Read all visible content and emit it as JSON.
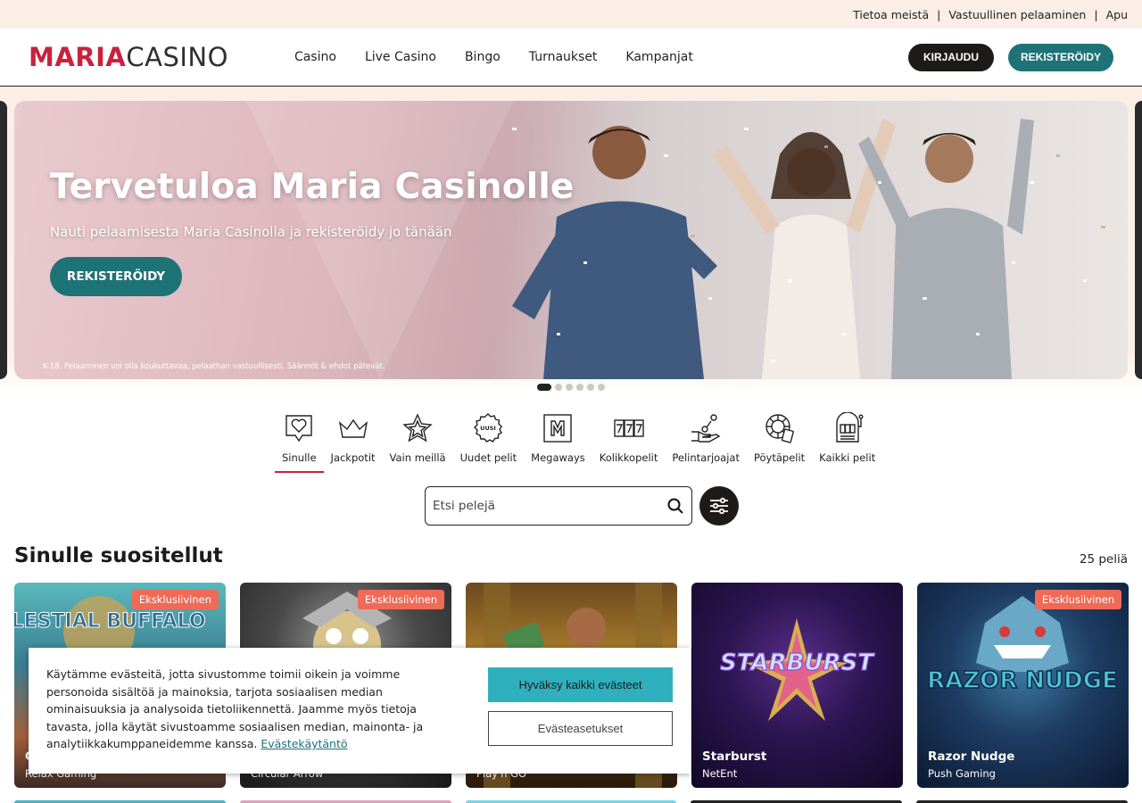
{
  "topbar": {
    "links": [
      "Tietoa meistä",
      "Vastuullinen pelaaminen",
      "Apu"
    ],
    "separator": "|"
  },
  "header": {
    "logo_part1": "MARIA",
    "logo_part2": "CASINO",
    "nav": [
      "Casino",
      "Live Casino",
      "Bingo",
      "Turnaukset",
      "Kampanjat"
    ],
    "login_label": "KIRJAUDU",
    "register_label": "REKISTERÖIDY"
  },
  "hero": {
    "title": "Tervetuloa Maria Casinolle",
    "subtitle": "Nauti pelaamisesta Maria Casinolla ja rekisteröidy jo tänään",
    "cta": "REKISTERÖIDY",
    "disclaimer": "K-18. Pelaaminen voi olla koukuttavaa, pelaathan vastuullisesti. Säännöt & ehdot pätevät.",
    "slides_count": 6,
    "active_slide": 1
  },
  "categories": [
    {
      "label": "Sinulle",
      "icon": "heart-chat-icon",
      "active": true
    },
    {
      "label": "Jackpotit",
      "icon": "crown-icon",
      "active": false
    },
    {
      "label": "Vain meillä",
      "icon": "star-icon",
      "active": false
    },
    {
      "label": "Uudet pelit",
      "icon": "new-badge-icon",
      "icon_text": "UUSI",
      "active": false
    },
    {
      "label": "Megaways",
      "icon": "megaways-icon",
      "active": false
    },
    {
      "label": "Kolikkopelit",
      "icon": "slot-777-icon",
      "active": false
    },
    {
      "label": "Pelintarjoajat",
      "icon": "hand-coin-icon",
      "active": false
    },
    {
      "label": "Pöytäpelit",
      "icon": "roulette-cards-icon",
      "active": false
    },
    {
      "label": "Kaikki pelit",
      "icon": "slot-machine-icon",
      "active": false
    }
  ],
  "search": {
    "placeholder": "Etsi pelejä"
  },
  "section": {
    "title": "Sinulle suositellut",
    "count": "25 peliä"
  },
  "games": [
    {
      "name": "C",
      "provider": "Relax Gaming",
      "badge": "Eksklusiivinen",
      "art_text": "CELESTIAL BUFFALO"
    },
    {
      "name": "",
      "provider": "Circular Arrow",
      "badge": "Eksklusiivinen"
    },
    {
      "name": "",
      "provider": "Play'n GO",
      "badge": ""
    },
    {
      "name": "Starburst",
      "provider": "NetEnt",
      "badge": "",
      "art_text": "STARBURST"
    },
    {
      "name": "Razor Nudge",
      "provider": "Push Gaming",
      "badge": "Eksklusiivinen",
      "art_text": "RAZOR NUDGE"
    }
  ],
  "cookie": {
    "text": "Käytämme evästeitä, jotta sivustomme toimii oikein ja voimme personoida sisältöä ja mainoksia, tarjota sosiaalisen median ominaisuuksia ja analysoida tietoliikennettä. Jaamme myös tietoja tavasta, jolla käytät sivustoamme sosiaalisen median, mainonta- ja analytiikkakumppaneidemme kanssa.",
    "link": "Evästekäytäntö",
    "accept": "Hyväksy kaikki evästeet",
    "settings": "Evästeasetukset"
  },
  "colors": {
    "brand_red": "#c8223f",
    "teal": "#1e7377",
    "cookie_accept": "#2fb0bd",
    "badge": "#ef6a57",
    "topbar_bg": "#fbeee6"
  }
}
